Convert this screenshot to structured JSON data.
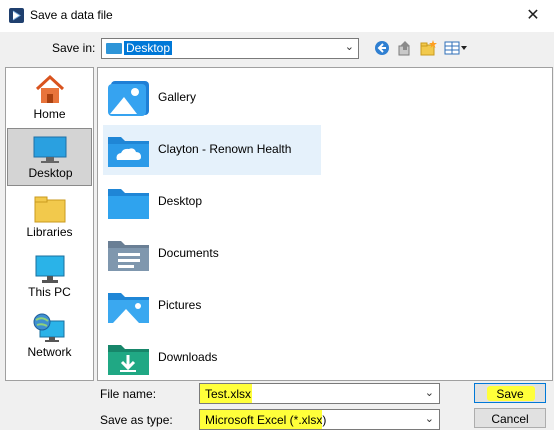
{
  "window": {
    "title": "Save a data file",
    "close_glyph": "✕"
  },
  "savein": {
    "label": "Save in:",
    "value": "Desktop"
  },
  "places": [
    {
      "label": "Home",
      "icon": "home-icon"
    },
    {
      "label": "Desktop",
      "icon": "desktop-icon",
      "selected": true
    },
    {
      "label": "Libraries",
      "icon": "libraries-icon"
    },
    {
      "label": "This PC",
      "icon": "this-pc-icon"
    },
    {
      "label": "Network",
      "icon": "network-icon"
    }
  ],
  "files": [
    {
      "name": "Gallery",
      "icon": "gallery-icon"
    },
    {
      "name": "Clayton - Renown Health",
      "icon": "onedrive-folder-icon",
      "highlighted": true
    },
    {
      "name": "Desktop",
      "icon": "desktop-folder-icon"
    },
    {
      "name": "Documents",
      "icon": "documents-folder-icon"
    },
    {
      "name": "Pictures",
      "icon": "pictures-folder-icon"
    },
    {
      "name": "Downloads",
      "icon": "downloads-folder-icon"
    }
  ],
  "filename": {
    "label": "File name:",
    "value": "Test.xlsx"
  },
  "filetype": {
    "label": "Save as type:",
    "value": "Microsoft Excel (*.xlsx)"
  },
  "buttons": {
    "save": "Save",
    "cancel": "Cancel"
  },
  "colors": {
    "accent": "#0078d7",
    "highlight": "#ffff3a",
    "selection": "#e5f1fb"
  }
}
